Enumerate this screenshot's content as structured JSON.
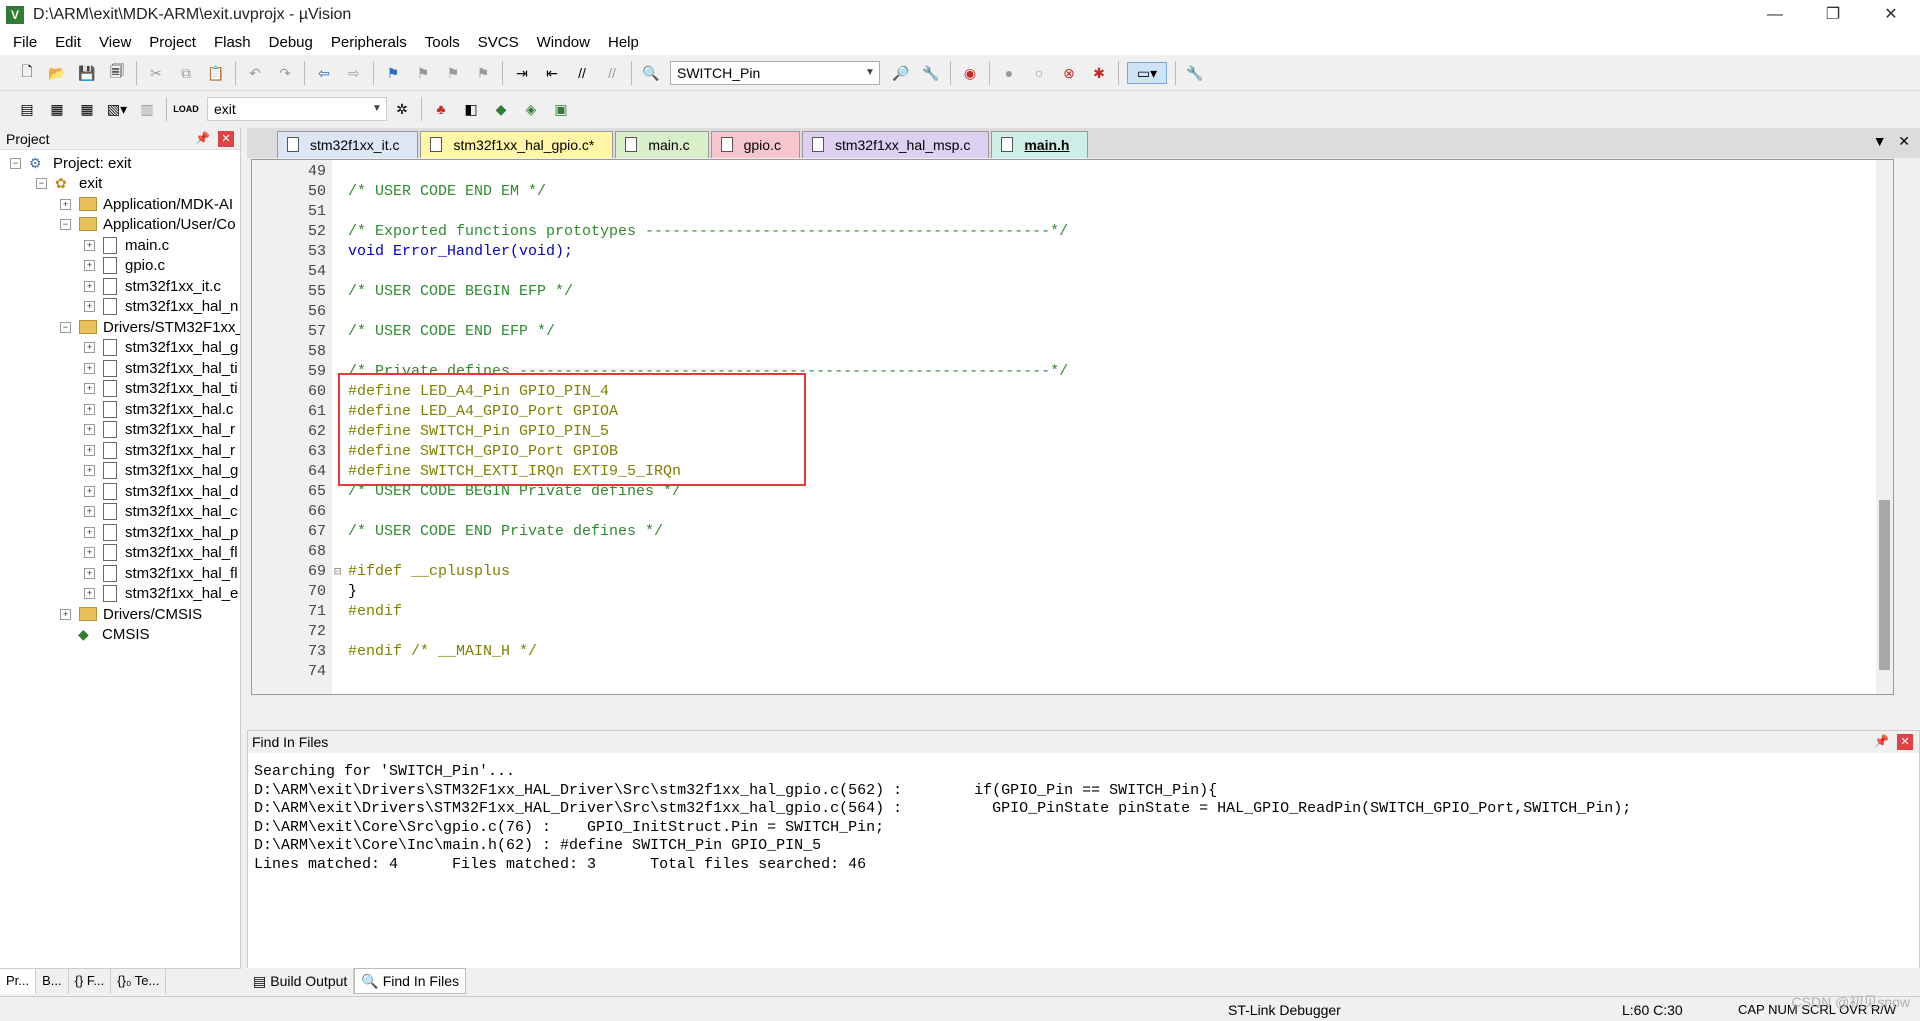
{
  "window": {
    "title": "D:\\ARM\\exit\\MDK-ARM\\exit.uvprojx - µVision"
  },
  "menu": [
    "File",
    "Edit",
    "View",
    "Project",
    "Flash",
    "Debug",
    "Peripherals",
    "Tools",
    "SVCS",
    "Window",
    "Help"
  ],
  "toolbar": {
    "find_combo": "SWITCH_Pin",
    "target_combo": "exit"
  },
  "project": {
    "title": "Project",
    "root": "Project: exit",
    "target": "exit",
    "items": [
      "Application/MDK-AI",
      "Application/User/Co",
      "main.c",
      "gpio.c",
      "stm32f1xx_it.c",
      "stm32f1xx_hal_n",
      "Drivers/STM32F1xx_",
      "stm32f1xx_hal_g",
      "stm32f1xx_hal_ti",
      "stm32f1xx_hal_ti",
      "stm32f1xx_hal.c",
      "stm32f1xx_hal_r",
      "stm32f1xx_hal_r",
      "stm32f1xx_hal_g",
      "stm32f1xx_hal_d",
      "stm32f1xx_hal_c",
      "stm32f1xx_hal_p",
      "stm32f1xx_hal_fl",
      "stm32f1xx_hal_fl",
      "stm32f1xx_hal_e",
      "Drivers/CMSIS",
      "CMSIS"
    ],
    "tabs": [
      "Pr...",
      "B...",
      "{} F...",
      "{}₀ Te..."
    ]
  },
  "editor": {
    "tabs": [
      "stm32f1xx_it.c",
      "stm32f1xx_hal_gpio.c*",
      "main.c",
      "gpio.c",
      "stm32f1xx_hal_msp.c",
      "main.h"
    ],
    "active_tab": "main.h",
    "lines": [
      {
        "n": "49",
        "t": ""
      },
      {
        "n": "50",
        "t": "/* USER CODE END EM */"
      },
      {
        "n": "51",
        "t": ""
      },
      {
        "n": "52",
        "t": "/* Exported functions prototypes ---------------------------------------------*/"
      },
      {
        "n": "53",
        "t": "void Error_Handler(void);"
      },
      {
        "n": "54",
        "t": ""
      },
      {
        "n": "55",
        "t": "/* USER CODE BEGIN EFP */"
      },
      {
        "n": "56",
        "t": ""
      },
      {
        "n": "57",
        "t": "/* USER CODE END EFP */"
      },
      {
        "n": "58",
        "t": ""
      },
      {
        "n": "59",
        "t": "/* Private defines -----------------------------------------------------------*/"
      },
      {
        "n": "60",
        "t": "#define LED_A4_Pin GPIO_PIN_4"
      },
      {
        "n": "61",
        "t": "#define LED_A4_GPIO_Port GPIOA"
      },
      {
        "n": "62",
        "t": "#define SWITCH_Pin GPIO_PIN_5"
      },
      {
        "n": "63",
        "t": "#define SWITCH_GPIO_Port GPIOB"
      },
      {
        "n": "64",
        "t": "#define SWITCH_EXTI_IRQn EXTI9_5_IRQn"
      },
      {
        "n": "65",
        "t": "/* USER CODE BEGIN Private defines */"
      },
      {
        "n": "66",
        "t": ""
      },
      {
        "n": "67",
        "t": "/* USER CODE END Private defines */"
      },
      {
        "n": "68",
        "t": ""
      },
      {
        "n": "69",
        "t": "#ifdef __cplusplus"
      },
      {
        "n": "70",
        "t": "}"
      },
      {
        "n": "71",
        "t": "#endif"
      },
      {
        "n": "72",
        "t": ""
      },
      {
        "n": "73",
        "t": "#endif /* __MAIN_H */"
      },
      {
        "n": "74",
        "t": ""
      }
    ]
  },
  "find_in_files": {
    "title": "Find In Files",
    "output": "Searching for 'SWITCH_Pin'...\nD:\\ARM\\exit\\Drivers\\STM32F1xx_HAL_Driver\\Src\\stm32f1xx_hal_gpio.c(562) :        if(GPIO_Pin == SWITCH_Pin){\nD:\\ARM\\exit\\Drivers\\STM32F1xx_HAL_Driver\\Src\\stm32f1xx_hal_gpio.c(564) :          GPIO_PinState pinState = HAL_GPIO_ReadPin(SWITCH_GPIO_Port,SWITCH_Pin);\nD:\\ARM\\exit\\Core\\Src\\gpio.c(76) :    GPIO_InitStruct.Pin = SWITCH_Pin;\nD:\\ARM\\exit\\Core\\Inc\\main.h(62) : #define SWITCH_Pin GPIO_PIN_5\nLines matched: 4      Files matched: 3      Total files searched: 46"
  },
  "bottom_tabs": [
    "Build Output",
    "Find In Files"
  ],
  "status": {
    "debugger": "ST-Link Debugger",
    "position": "L:60 C:30",
    "flags": "CAP  NUM  SCRL  OVR  R/W"
  },
  "watermark": "CSDN @初见snow"
}
